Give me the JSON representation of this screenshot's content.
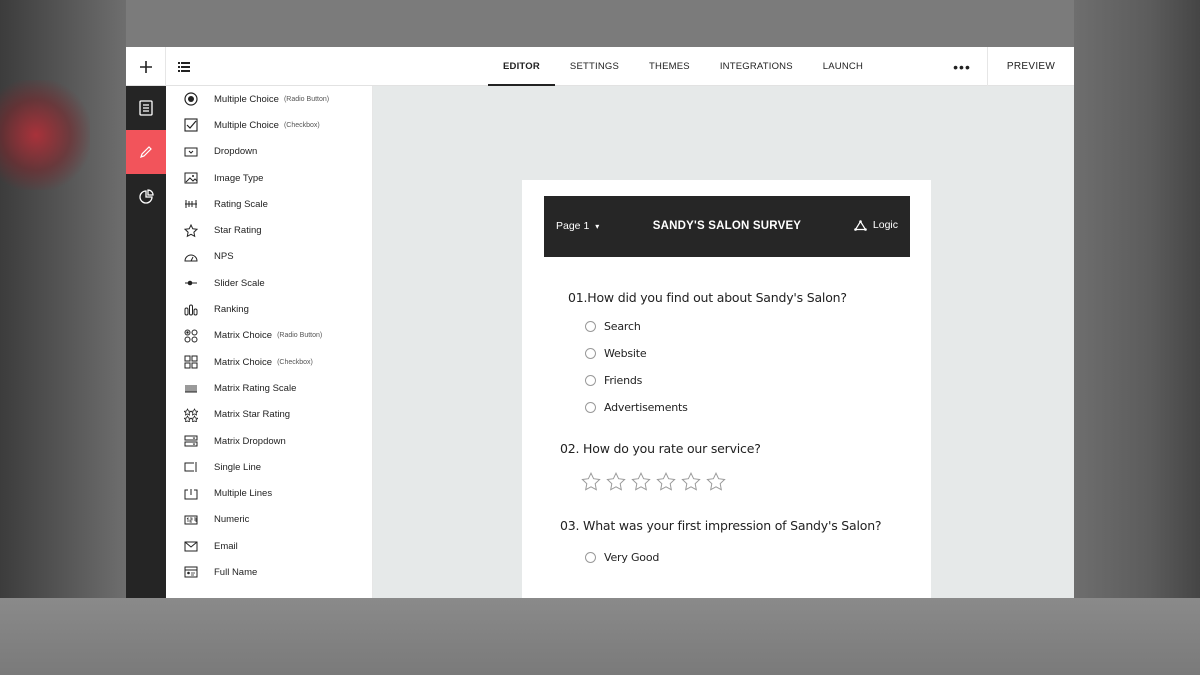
{
  "topbar": {
    "tabs": [
      {
        "label": "EDITOR",
        "active": true
      },
      {
        "label": "SETTINGS",
        "active": false
      },
      {
        "label": "THEMES",
        "active": false
      },
      {
        "label": "INTEGRATIONS",
        "active": false
      },
      {
        "label": "LAUNCH",
        "active": false
      }
    ],
    "more_label": "•••",
    "preview_label": "PREVIEW"
  },
  "rail": {
    "items": [
      {
        "icon": "document-icon",
        "active": false
      },
      {
        "icon": "pencil-icon",
        "active": true
      },
      {
        "icon": "pie-chart-icon",
        "active": false
      }
    ]
  },
  "palette": {
    "items": [
      {
        "label": "Multiple Choice",
        "sub": "(Radio Button)",
        "icon": "radio-button-icon"
      },
      {
        "label": "Multiple Choice",
        "sub": "(Checkbox)",
        "icon": "checkbox-icon"
      },
      {
        "label": "Dropdown",
        "sub": "",
        "icon": "dropdown-icon"
      },
      {
        "label": "Image Type",
        "sub": "",
        "icon": "image-icon"
      },
      {
        "label": "Rating Scale",
        "sub": "",
        "icon": "rating-scale-icon"
      },
      {
        "label": "Star Rating",
        "sub": "",
        "icon": "star-icon"
      },
      {
        "label": "NPS",
        "sub": "",
        "icon": "gauge-icon"
      },
      {
        "label": "Slider Scale",
        "sub": "",
        "icon": "slider-icon"
      },
      {
        "label": "Ranking",
        "sub": "",
        "icon": "ranking-icon"
      },
      {
        "label": "Matrix Choice",
        "sub": "(Radio Button)",
        "icon": "matrix-radio-icon"
      },
      {
        "label": "Matrix Choice",
        "sub": "(Checkbox)",
        "icon": "matrix-checkbox-icon"
      },
      {
        "label": "Matrix Rating Scale",
        "sub": "",
        "icon": "matrix-rating-icon"
      },
      {
        "label": "Matrix Star Rating",
        "sub": "",
        "icon": "matrix-star-icon"
      },
      {
        "label": "Matrix Dropdown",
        "sub": "",
        "icon": "matrix-dropdown-icon"
      },
      {
        "label": "Single Line",
        "sub": "",
        "icon": "single-line-icon"
      },
      {
        "label": "Multiple Lines",
        "sub": "",
        "icon": "multiple-lines-icon"
      },
      {
        "label": "Numeric",
        "sub": "",
        "icon": "numeric-icon"
      },
      {
        "label": "Email",
        "sub": "",
        "icon": "email-icon"
      },
      {
        "label": "Full Name",
        "sub": "",
        "icon": "full-name-icon"
      }
    ]
  },
  "survey": {
    "page_label": "Page 1",
    "page_caret": "▾",
    "title": "SANDY'S SALON SURVEY",
    "logic_label": "Logic",
    "q1": {
      "text": "01.How did you find out about Sandy's Salon?",
      "options": [
        "Search",
        "Website",
        "Friends",
        "Advertisements"
      ]
    },
    "q2": {
      "text": "02. How do you rate our service?",
      "stars": 6
    },
    "q3": {
      "text": "03. What was your first impression of Sandy's Salon?",
      "options": [
        "Very Good"
      ]
    }
  },
  "colors": {
    "accent": "#f2545b",
    "rail": "#252525",
    "header": "#262626",
    "canvas": "#e6e9e9"
  }
}
